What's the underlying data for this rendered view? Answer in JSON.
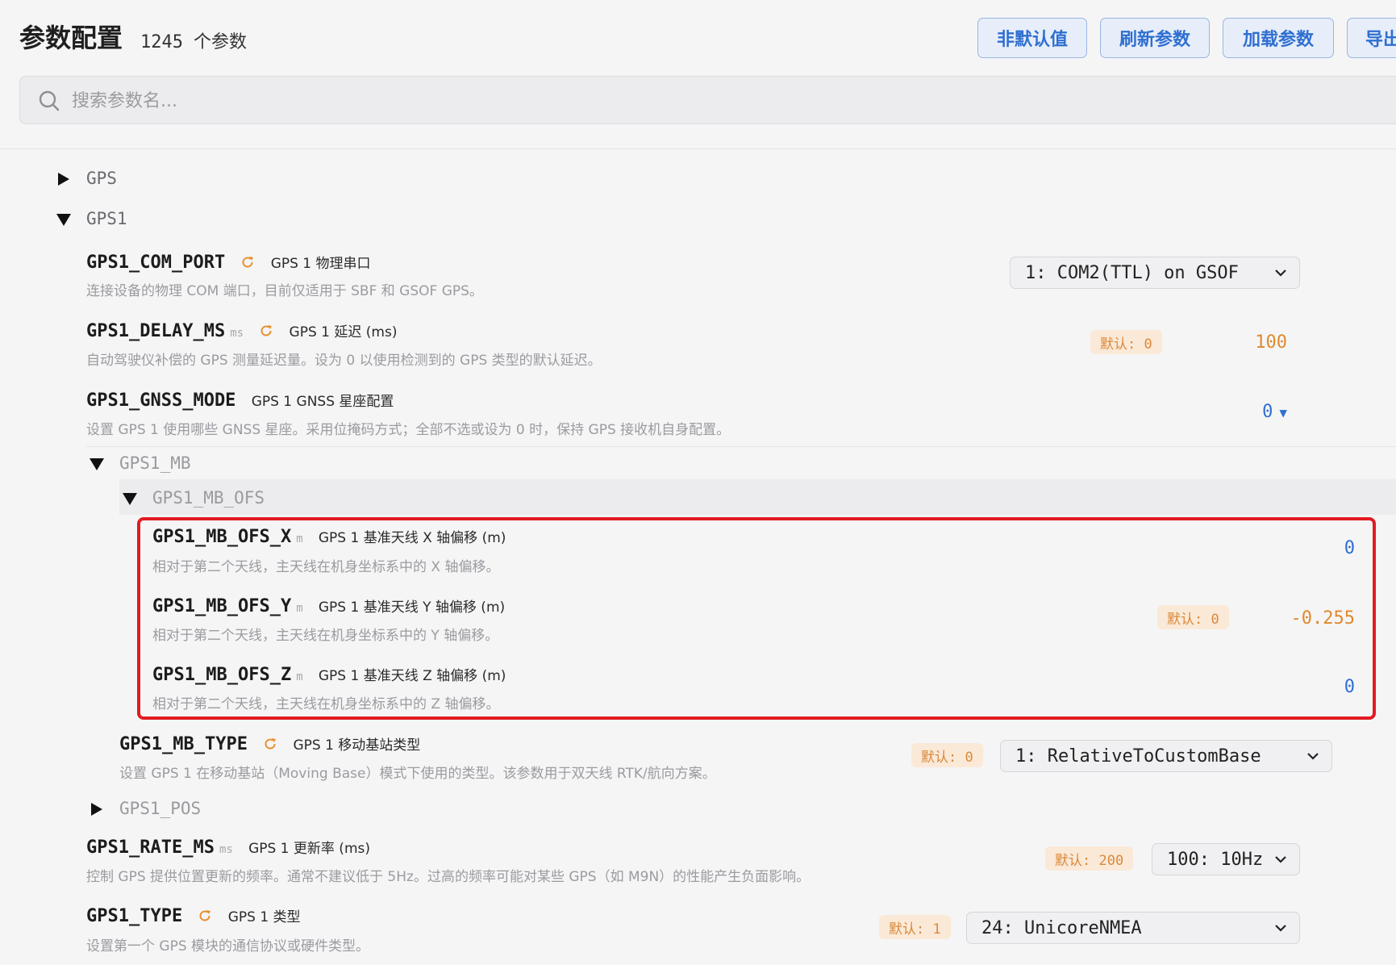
{
  "header": {
    "title": "参数配置",
    "count": "1245",
    "count_unit": "个参数",
    "buttons": [
      "非默认值",
      "刷新参数",
      "加载参数",
      "导出"
    ]
  },
  "search": {
    "placeholder": "搜索参数名..."
  },
  "groups": {
    "gps": "GPS",
    "gps1": "GPS1",
    "gps1_mb": "GPS1_MB",
    "gps1_mb_ofs": "GPS1_MB_OFS",
    "gps1_pos": "GPS1_POS"
  },
  "params": [
    {
      "name": "GPS1_COM_PORT",
      "unit": "",
      "reboot": true,
      "title": "GPS 1 物理串口",
      "desc": "连接设备的物理 COM 端口，目前仅适用于 SBF 和 GSOF GPS。",
      "default": "",
      "value": "1: COM2(TTL) on GSOF"
    },
    {
      "name": "GPS1_DELAY_MS",
      "unit": "ms",
      "reboot": true,
      "title": "GPS 1 延迟 (ms)",
      "desc": "自动驾驶仪补偿的 GPS 测量延迟量。设为 0 以使用检测到的 GPS 类型的默认延迟。",
      "default": "默认: 0",
      "value": "100"
    },
    {
      "name": "GPS1_GNSS_MODE",
      "unit": "",
      "reboot": false,
      "title": "GPS 1 GNSS 星座配置",
      "desc": "设置 GPS 1 使用哪些 GNSS 星座。采用位掩码方式；全部不选或设为 0 时，保持 GPS 接收机自身配置。",
      "default": "",
      "value": "0",
      "value_arrow": "▼"
    },
    {
      "name": "GPS1_MB_OFS_X",
      "unit": "m",
      "reboot": false,
      "title": "GPS 1 基准天线 X 轴偏移 (m)",
      "desc": "相对于第二个天线，主天线在机身坐标系中的 X 轴偏移。",
      "default": "",
      "value": "0"
    },
    {
      "name": "GPS1_MB_OFS_Y",
      "unit": "m",
      "reboot": false,
      "title": "GPS 1 基准天线 Y 轴偏移 (m)",
      "desc": "相对于第二个天线，主天线在机身坐标系中的 Y 轴偏移。",
      "default": "默认: 0",
      "value": "-0.255"
    },
    {
      "name": "GPS1_MB_OFS_Z",
      "unit": "m",
      "reboot": false,
      "title": "GPS 1 基准天线 Z 轴偏移 (m)",
      "desc": "相对于第二个天线，主天线在机身坐标系中的 Z 轴偏移。",
      "default": "",
      "value": "0"
    },
    {
      "name": "GPS1_MB_TYPE",
      "unit": "",
      "reboot": true,
      "title": "GPS 1 移动基站类型",
      "desc": "设置 GPS 1 在移动基站（Moving Base）模式下使用的类型。该参数用于双天线 RTK/航向方案。",
      "default": "默认: 0",
      "value": "1: RelativeToCustomBase"
    },
    {
      "name": "GPS1_RATE_MS",
      "unit": "ms",
      "reboot": false,
      "title": "GPS 1 更新率 (ms)",
      "desc": "控制 GPS 提供位置更新的频率。通常不建议低于 5Hz。过高的频率可能对某些 GPS（如 M9N）的性能产生负面影响。",
      "default": "默认: 200",
      "value": "100: 10Hz"
    },
    {
      "name": "GPS1_TYPE",
      "unit": "",
      "reboot": true,
      "title": "GPS 1 类型",
      "desc": "设置第一个 GPS 模块的通信协议或硬件类型。",
      "default": "默认: 1",
      "value": "24: UnicoreNMEA"
    }
  ],
  "colors": {
    "accent": "#2f6fd1",
    "changed": "#e08a2c",
    "highlight": "#e21b23",
    "badge_bg": "#fbe9d8"
  },
  "icons": {
    "search": "search-icon",
    "reboot": "reboot-icon",
    "expand": "triangle-right-icon",
    "collapse": "triangle-down-icon",
    "dropdown": "chevron-down-icon"
  }
}
